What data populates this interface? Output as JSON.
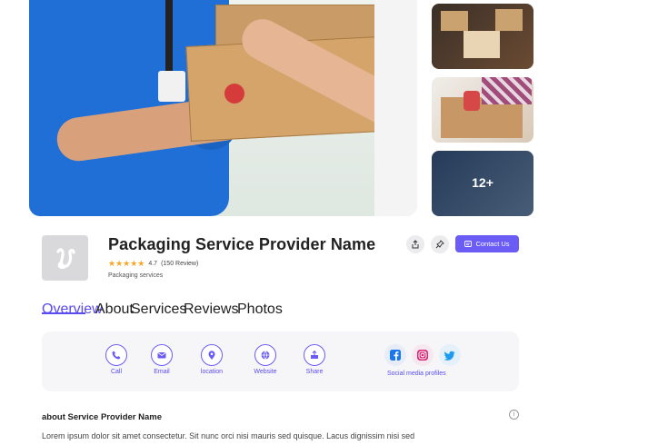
{
  "gallery": {
    "more_count": "12+"
  },
  "provider": {
    "name": "Packaging Service Provider Name",
    "stars": "★★★★★",
    "rating": "4.7",
    "reviews": "(150 Review)",
    "category": "Packaging services",
    "contact_label": "Contact Us"
  },
  "tabs": [
    "Overview",
    "About",
    "Services",
    "Reviews",
    "Photos"
  ],
  "actions": [
    {
      "label": "Call",
      "icon": "phone-icon"
    },
    {
      "label": "Email",
      "icon": "email-icon"
    },
    {
      "label": "location",
      "icon": "location-icon"
    },
    {
      "label": "Website",
      "icon": "globe-icon"
    },
    {
      "label": "Share",
      "icon": "share-icon"
    }
  ],
  "social": {
    "label": "Social media profiles",
    "icons": [
      "facebook-icon",
      "instagram-icon",
      "twitter-icon"
    ]
  },
  "about": {
    "title": "about Service Provider Name",
    "text": "Lorem ipsum dolor sit amet consectetur. Sit nunc orci nisi mauris sed quisque. Lacus dignissim nisi sed"
  },
  "colors": {
    "accent": "#6a5cf5",
    "star": "#f6a623"
  }
}
